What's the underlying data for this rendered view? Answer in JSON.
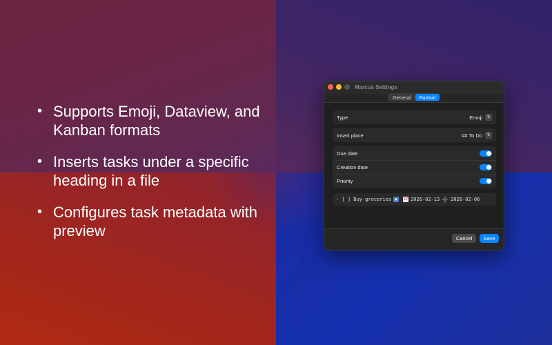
{
  "bullets": [
    "Supports Emoji, Dataview, and Kanban formats",
    "Inserts tasks under a specific heading in a file",
    "Configures task metadata with preview"
  ],
  "window": {
    "title": "Marcus Settings",
    "tabs": [
      "General",
      "Format"
    ],
    "active_tab": "Format",
    "settings": {
      "type": {
        "label": "Type",
        "value": "Emoji"
      },
      "insert_place": {
        "label": "Insert place",
        "value": "## To Do"
      },
      "toggles": [
        {
          "label": "Due date",
          "on": true
        },
        {
          "label": "Creation date",
          "on": true
        },
        {
          "label": "Priority",
          "on": true
        }
      ]
    },
    "preview": {
      "task": "- [ ] Buy groceries",
      "due": "2026-02-13",
      "created": "2026-02-06"
    },
    "buttons": {
      "cancel": "Cancel",
      "save": "Save"
    }
  },
  "colors": {
    "accent": "#0a84ff",
    "window_bg": "#262626",
    "close": "#ff5f57",
    "minimize": "#febc2e"
  }
}
